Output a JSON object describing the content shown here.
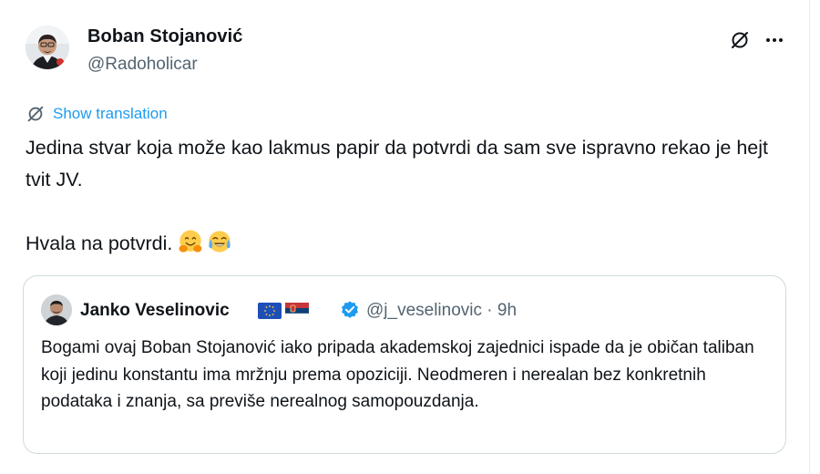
{
  "author": {
    "name": "Boban Stojanović",
    "handle": "@Radoholicar"
  },
  "actions": {
    "grok_icon": "grok-icon",
    "more_icon": "more-icon"
  },
  "translation": {
    "label": "Show translation"
  },
  "tweet": {
    "line1": "Jedina stvar koja može kao lakmus papir da potvrdi da sam sve ispravno rekao je hejt tvit JV.",
    "line2": "Hvala na potvrdi.",
    "emojis": [
      "hugging-face-emoji",
      "tears-of-joy-emoji"
    ]
  },
  "quoted": {
    "name": "Janko Veselinovic",
    "flags": [
      "eu-flag-icon",
      "serbia-flag-icon"
    ],
    "verified": true,
    "handle": "@j_veselinovic",
    "separator": "·",
    "time": "9h",
    "text": "Bogami ovaj Boban Stojanović iako pripada akademskoj zajednici ispade da je običan taliban koji jedinu konstantu ima mržnju prema opoziciji. Neodmeren i nerealan bez konkretnih podataka i znanja, sa previše nerealnog samopouzdanja."
  },
  "colors": {
    "accent": "#1d9bf0",
    "secondary_text": "#536471",
    "border": "#cfd9de"
  }
}
